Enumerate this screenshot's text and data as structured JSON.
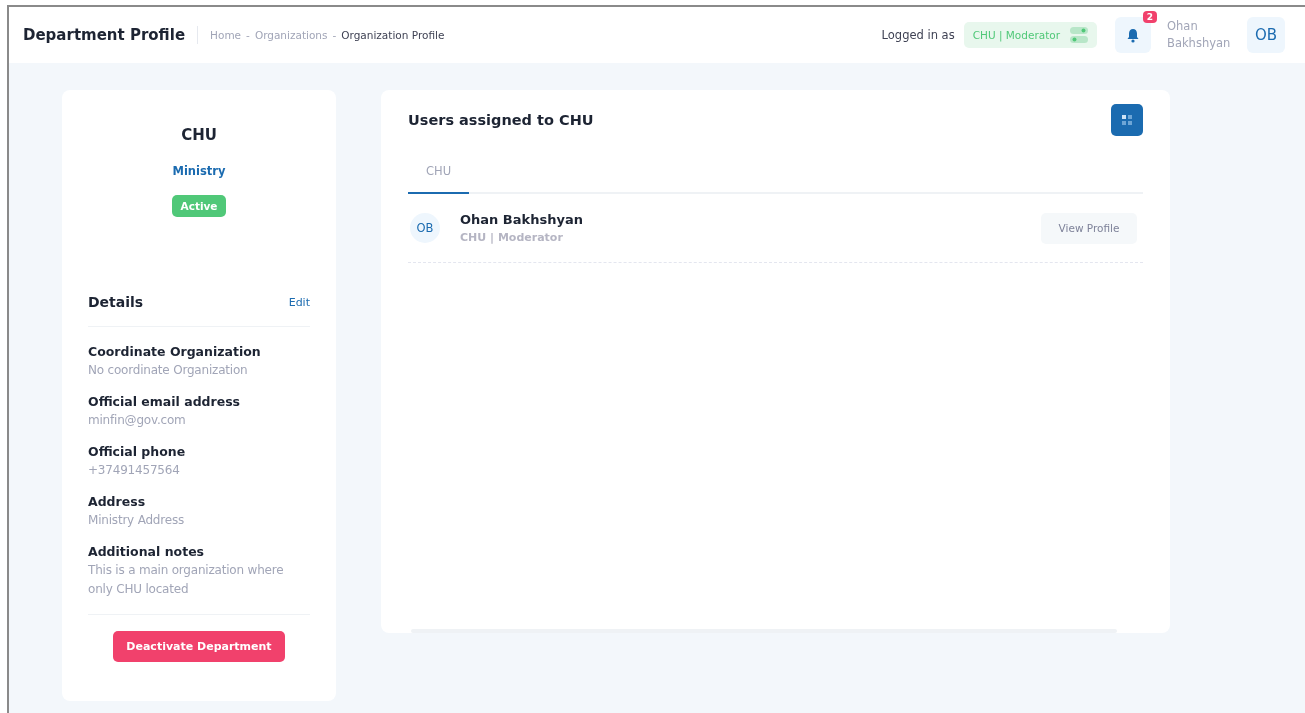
{
  "header": {
    "title": "Department Profile",
    "breadcrumb": [
      {
        "label": "Home",
        "current": false
      },
      {
        "label": "Organizations",
        "current": false
      },
      {
        "label": "Organization Profile",
        "current": true
      }
    ],
    "breadcrumb_separator": "-",
    "logged_in_label": "Logged in as",
    "role": "CHU | Moderator",
    "notification_count": "2",
    "user_name": "Ohan Bakhshyan",
    "user_initials": "OB"
  },
  "organization": {
    "name": "CHU",
    "type": "Ministry",
    "status": {
      "label": "Active",
      "active": true
    },
    "details_title": "Details",
    "edit_label": "Edit",
    "fields": [
      {
        "label": "Coordinate Organization",
        "value": "No coordinate Organization"
      },
      {
        "label": "Official email address",
        "value": "minfin@gov.com"
      },
      {
        "label": "Official phone",
        "value": "+37491457564"
      },
      {
        "label": "Address",
        "value": "Ministry Address"
      },
      {
        "label": "Additional notes",
        "value": "This is a main organization where only CHU located"
      }
    ],
    "deactivate_label": "Deactivate Department"
  },
  "users_panel": {
    "title": "Users assigned to CHU",
    "tabs": [
      {
        "label": "CHU",
        "selected": true
      }
    ],
    "users": [
      {
        "initials": "OB",
        "name": "Ohan Bakhshyan",
        "role": "CHU | Moderator",
        "action": "View Profile"
      }
    ]
  }
}
